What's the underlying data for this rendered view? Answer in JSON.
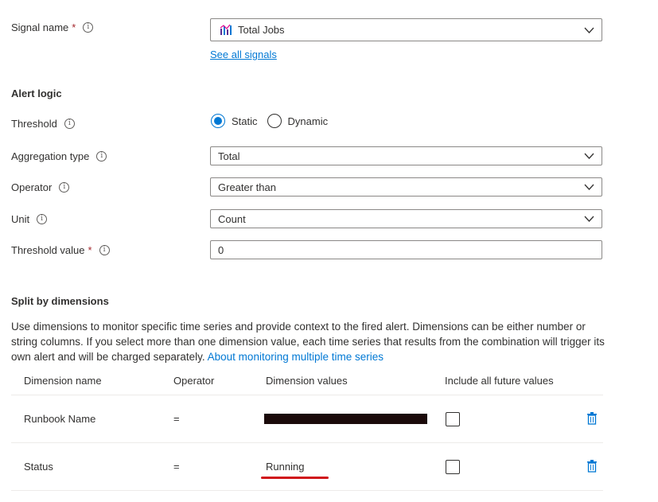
{
  "signal": {
    "label": "Signal name",
    "required_mark": "*",
    "value": "Total Jobs",
    "see_all_link": "See all signals"
  },
  "alert_logic": {
    "title": "Alert logic",
    "threshold": {
      "label": "Threshold",
      "options": [
        "Static",
        "Dynamic"
      ],
      "selected": "Static"
    },
    "aggregation": {
      "label": "Aggregation type",
      "value": "Total"
    },
    "operator": {
      "label": "Operator",
      "value": "Greater than"
    },
    "unit": {
      "label": "Unit",
      "value": "Count"
    },
    "threshold_value": {
      "label": "Threshold value",
      "required_mark": "*",
      "value": "0"
    }
  },
  "split": {
    "title": "Split by dimensions",
    "description": "Use dimensions to monitor specific time series and provide context to the fired alert. Dimensions can be either number or string columns. If you select more than one dimension value, each time series that results from the combination will trigger its own alert and will be charged separately.",
    "link": "About monitoring multiple time series",
    "columns": [
      "Dimension name",
      "Operator",
      "Dimension values",
      "Include all future values"
    ],
    "rows": [
      {
        "name": "Runbook Name",
        "operator": "=",
        "value": "",
        "redacted": true,
        "include_future": false
      },
      {
        "name": "Status",
        "operator": "=",
        "value": "Running",
        "redacted": false,
        "include_future": false
      }
    ]
  },
  "colors": {
    "accent": "#0078d4",
    "text": "#323130",
    "border": "#8a8886",
    "redaction": "#1b0a0a",
    "annotation_underline": "#d0141a",
    "delete_icon": "#0078d4"
  },
  "icons": {
    "info": "info-icon",
    "signal": "metric-bar-icon",
    "chevron": "chevron-down-icon",
    "delete": "trash-icon"
  }
}
